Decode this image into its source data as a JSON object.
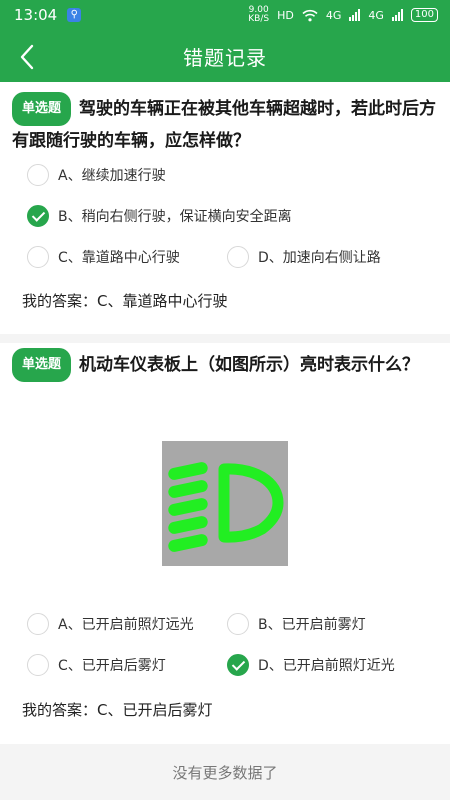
{
  "status": {
    "time": "13:04",
    "speed_value": "9.00",
    "speed_unit": "KB/S",
    "hd": "HD",
    "net1": "4G",
    "net2": "4G",
    "battery": "100"
  },
  "header": {
    "title": "错题记录"
  },
  "questions": [
    {
      "tag": "单选题",
      "text": "驾驶的车辆正在被其他车辆超越时，若此时后方有跟随行驶的车辆，应怎样做？",
      "options": [
        {
          "label": "A、继续加速行驶",
          "checked": false
        },
        {
          "label": "B、稍向右侧行驶，保证横向安全距离",
          "checked": true
        },
        {
          "label": "C、靠道路中心行驶",
          "checked": false
        },
        {
          "label": "D、加速向右侧让路",
          "checked": false
        }
      ],
      "answer_label": "我的答案：",
      "answer_value": "C、靠道路中心行驶"
    },
    {
      "tag": "单选题",
      "text": "机动车仪表板上（如图所示）亮时表示什么？",
      "image_icon": "headlight-low-beam-icon",
      "options": [
        {
          "label": "A、已开启前照灯远光",
          "checked": false
        },
        {
          "label": "B、已开启前雾灯",
          "checked": false
        },
        {
          "label": "C、已开启后雾灯",
          "checked": false
        },
        {
          "label": "D、已开启前照灯近光",
          "checked": true
        }
      ],
      "answer_label": "我的答案：",
      "answer_value": "C、已开启后雾灯"
    }
  ],
  "footer": {
    "text": "没有更多数据了"
  },
  "colors": {
    "primary": "#27a64c",
    "indicator": "#22ee22",
    "image_bg": "#a8a8a8"
  }
}
